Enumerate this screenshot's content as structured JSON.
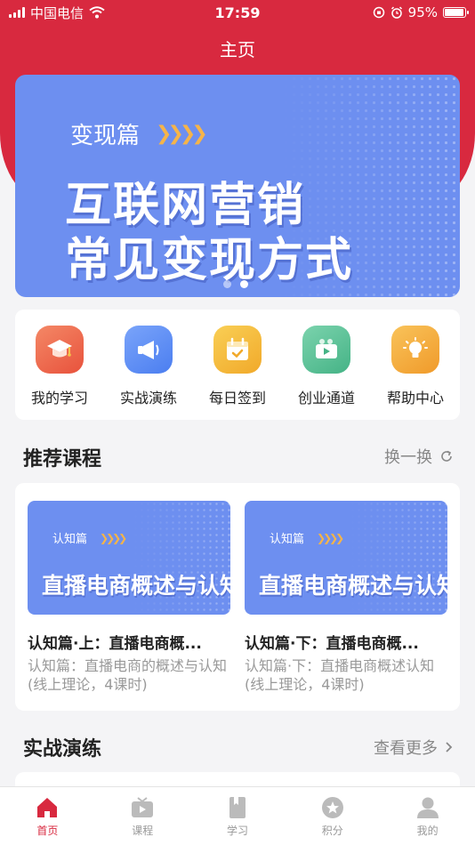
{
  "status": {
    "carrier": "中国电信",
    "time": "17:59",
    "battery": "95%",
    "battery_level": 0.95
  },
  "nav": {
    "title": "主页"
  },
  "banner": {
    "tag": "变现篇",
    "line1": "互联网营销",
    "line2": "常见变现方式",
    "pages": 2,
    "active_page": 2
  },
  "quick": [
    {
      "label": "我的学习",
      "icon": "graduation-cap-icon",
      "color": "#ef6a4c"
    },
    {
      "label": "实战演练",
      "icon": "megaphone-icon",
      "color": "#5b8ef2"
    },
    {
      "label": "每日签到",
      "icon": "calendar-check-icon",
      "color": "#f5b63a"
    },
    {
      "label": "创业通道",
      "icon": "video-camera-icon",
      "color": "#5fc49a"
    },
    {
      "label": "帮助中心",
      "icon": "lightbulb-icon",
      "color": "#f5a83a"
    }
  ],
  "recommend": {
    "title": "推荐课程",
    "action": "换一换"
  },
  "courses": [
    {
      "thumb_tag": "认知篇",
      "thumb_title": "直播电商概述与认知",
      "name": "认知篇·上：直播电商概...",
      "desc": "认知篇：直播电商的概述与认知(线上理论，4课时)"
    },
    {
      "thumb_tag": "认知篇",
      "thumb_title": "直播电商概述与认知",
      "name": "认知篇·下：直播电商概...",
      "desc": "认知篇·下：直播电商概述认知(线上理论，4课时)"
    }
  ],
  "practice": {
    "title": "实战演练",
    "action": "查看更多"
  },
  "tabs": [
    {
      "label": "首页",
      "icon": "home-icon",
      "active": true
    },
    {
      "label": "课程",
      "icon": "tv-play-icon",
      "active": false
    },
    {
      "label": "学习",
      "icon": "book-icon",
      "active": false
    },
    {
      "label": "积分",
      "icon": "star-icon",
      "active": false
    },
    {
      "label": "我的",
      "icon": "user-icon",
      "active": false
    }
  ],
  "colors": {
    "brand_red": "#d8293f",
    "banner_blue": "#6d8ff0",
    "accent_orange": "#f5b44a"
  }
}
